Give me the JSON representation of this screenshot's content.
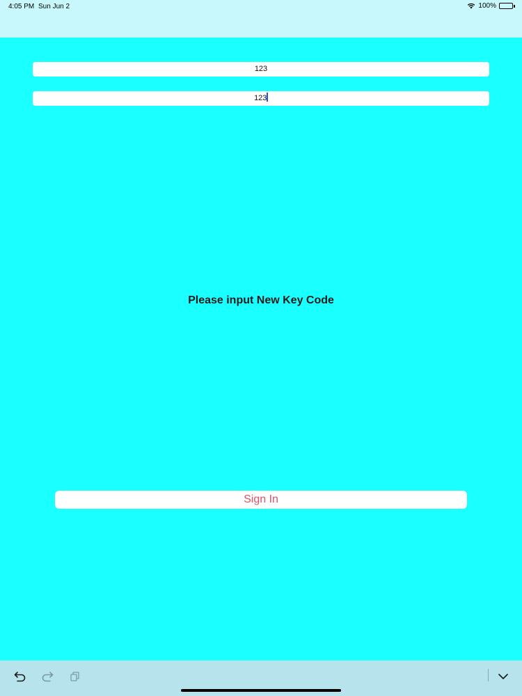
{
  "status_bar": {
    "time": "4:05 PM",
    "date": "Sun Jun 2",
    "battery": "100%",
    "wifi_icon": "wifi-icon",
    "battery_icon": "battery-icon"
  },
  "form": {
    "field_1_value": "123",
    "field_2_value": "123",
    "prompt": "Please input New Key Code",
    "sign_in_label": "Sign In"
  },
  "toolbar": {
    "icons": [
      "undo-icon",
      "redo-icon",
      "paste-icon",
      "chevron-down-icon"
    ]
  },
  "colors": {
    "background": "#1affff",
    "status_bar": "#c8f8fb",
    "toolbar": "#b7e4ec",
    "button_text": "#d9546a",
    "caret": "#2255dd"
  }
}
